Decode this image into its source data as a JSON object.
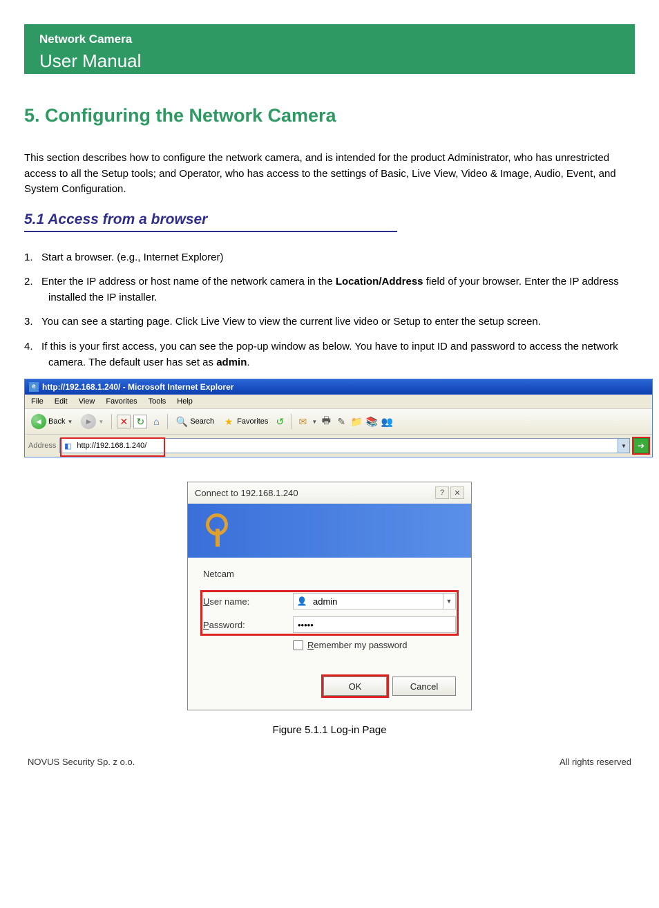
{
  "banner": {
    "top": "Network Camera",
    "bottom": "User Manual"
  },
  "chapter_title": "5. Configuring the Network Camera",
  "intro_para": "This section describes how to configure the network camera, and is intended for the product Administrator, who has unrestricted access to all the Setup tools; and Operator, who has access to the settings of Basic, Live View, Video & Image, Audio, Event, and System Configuration.",
  "subhead": "5.1 Access from a browser",
  "steps": {
    "s1": {
      "num": "1.",
      "text": "Start a browser. (e.g., Internet Explorer)"
    },
    "s2": {
      "num": "2.",
      "prefix": "Enter the IP address or host name of the network camera in the ",
      "bold": "Location/Address",
      "suffix": " field of your browser. Enter the IP address installed the IP installer."
    },
    "s3": {
      "num": "3.",
      "text": "You can see a starting page. Click Live View to view the current live video or Setup to enter the setup screen."
    },
    "s4": {
      "num": "4.",
      "prefix": "If this is your first access, you can see the pop-up window as below. You have to input ID and password to access the network camera. The default user has set as ",
      "bold": "admin",
      "suffix": "."
    }
  },
  "browser": {
    "title": "http://192.168.1.240/ - Microsoft Internet Explorer",
    "menu": {
      "file": "File",
      "edit": "Edit",
      "view": "View",
      "favorites": "Favorites",
      "tools": "Tools",
      "help": "Help"
    },
    "toolbar": {
      "back": "Back",
      "search": "Search",
      "favorites": "Favorites"
    },
    "address_label": "Address",
    "address_value": "http://192.168.1.240/"
  },
  "dialog": {
    "title": "Connect to 192.168.1.240",
    "realm": "Netcam",
    "username_label_u": "U",
    "username_label_rest": "ser name:",
    "password_label_p": "P",
    "password_label_rest": "assword:",
    "username_value": "admin",
    "password_value": "•••••",
    "remember_r": "R",
    "remember_rest": "emember my password",
    "ok": "OK",
    "cancel": "Cancel"
  },
  "figure_caption": "Figure 5.1.1 Log-in Page",
  "footer": {
    "left": "NOVUS Security Sp. z o.o.",
    "right": "All rights reserved"
  }
}
